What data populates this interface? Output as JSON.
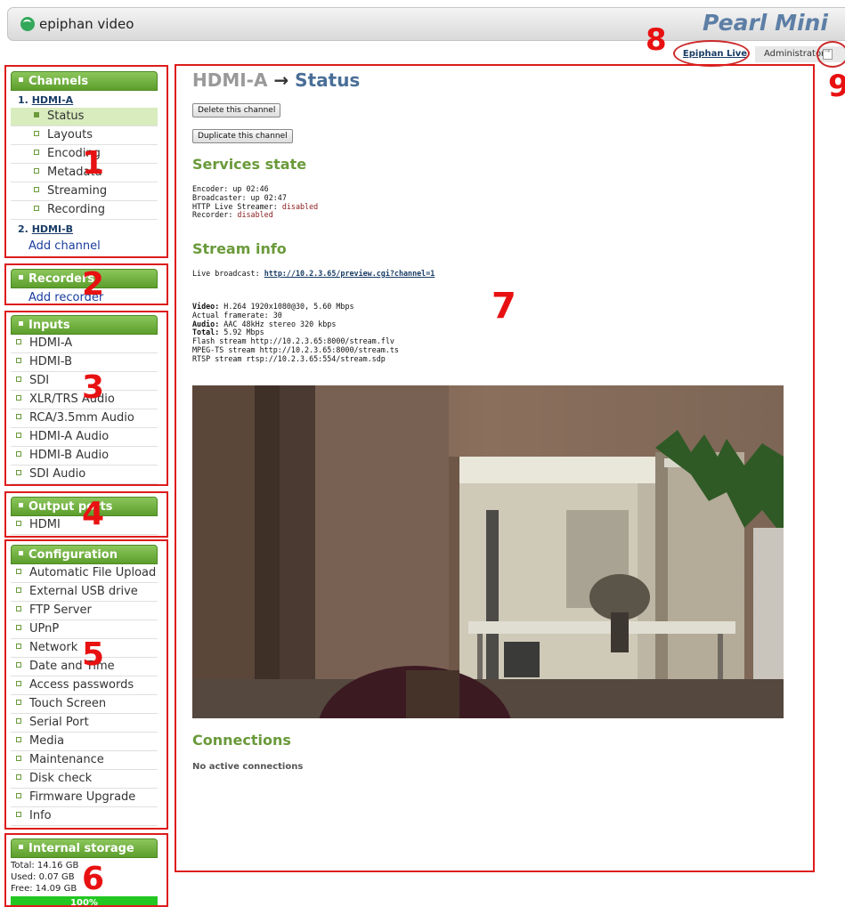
{
  "header": {
    "logo_text": "epiphan video",
    "product_name": "Pearl Mini",
    "live_link": "Epiphan Live",
    "user_label": "Administrator"
  },
  "annotations": [
    "1",
    "2",
    "3",
    "4",
    "5",
    "6",
    "7",
    "8",
    "9"
  ],
  "sidebar": {
    "channels": {
      "title": "Channels",
      "channel_a": {
        "number": "1.",
        "name": "HDMI-A"
      },
      "items": [
        "Status",
        "Layouts",
        "Encoding",
        "Metadata",
        "Streaming",
        "Recording"
      ],
      "channel_b": {
        "number": "2.",
        "name": "HDMI-B"
      },
      "add_channel": "Add channel"
    },
    "recorders": {
      "title": "Recorders",
      "add_recorder": "Add recorder"
    },
    "inputs": {
      "title": "Inputs",
      "items": [
        "HDMI-A",
        "HDMI-B",
        "SDI",
        "XLR/TRS Audio",
        "RCA/3.5mm Audio",
        "HDMI-A Audio",
        "HDMI-B Audio",
        "SDI Audio"
      ]
    },
    "output_ports": {
      "title": "Output ports",
      "items": [
        "HDMI"
      ]
    },
    "configuration": {
      "title": "Configuration",
      "items": [
        "Automatic File Upload",
        "External USB drive",
        "FTP Server",
        "UPnP",
        "Network",
        "Date and Time",
        "Access passwords",
        "Touch Screen",
        "Serial Port",
        "Media",
        "Maintenance",
        "Disk check",
        "Firmware Upgrade",
        "Info"
      ]
    },
    "storage": {
      "title": "Internal storage",
      "total": "Total: 14.16 GB",
      "used": "Used: 0.07 GB",
      "free": "Free: 14.09 GB",
      "percent_label": "100%",
      "free_fraction": 1.0
    }
  },
  "main": {
    "title_channel": "HDMI-A",
    "title_arrow": "→",
    "title_page": "Status",
    "delete_button": "Delete this channel",
    "duplicate_button": "Duplicate this channel",
    "services_title": "Services state",
    "services": {
      "encoder": "Encoder: up 02:46",
      "broadcaster": "Broadcaster: up 02:47",
      "hls_label": "HTTP Live Streamer: ",
      "hls_value": "disabled",
      "recorder_label": "Recorder: ",
      "recorder_value": "disabled"
    },
    "stream_title": "Stream info",
    "stream": {
      "live_label": "Live broadcast: ",
      "live_url": "http://10.2.3.65/preview.cgi?channel=1",
      "video_label": "Video:",
      "video_value": " H.264 1920x1080@30, 5.60 Mbps",
      "framerate": "Actual framerate: 30",
      "audio_label": "Audio:",
      "audio_value": " AAC 48kHz stereo 320 kbps",
      "total_label": "Total:",
      "total_value": " 5.92 Mbps",
      "flash": "Flash stream http://10.2.3.65:8000/stream.flv",
      "mpegts": "MPEG-TS stream http://10.2.3.65:8000/stream.ts",
      "rtsp": "RTSP stream rtsp://10.2.3.65:554/stream.sdp"
    },
    "connections_title": "Connections",
    "no_connections": "No active connections"
  }
}
